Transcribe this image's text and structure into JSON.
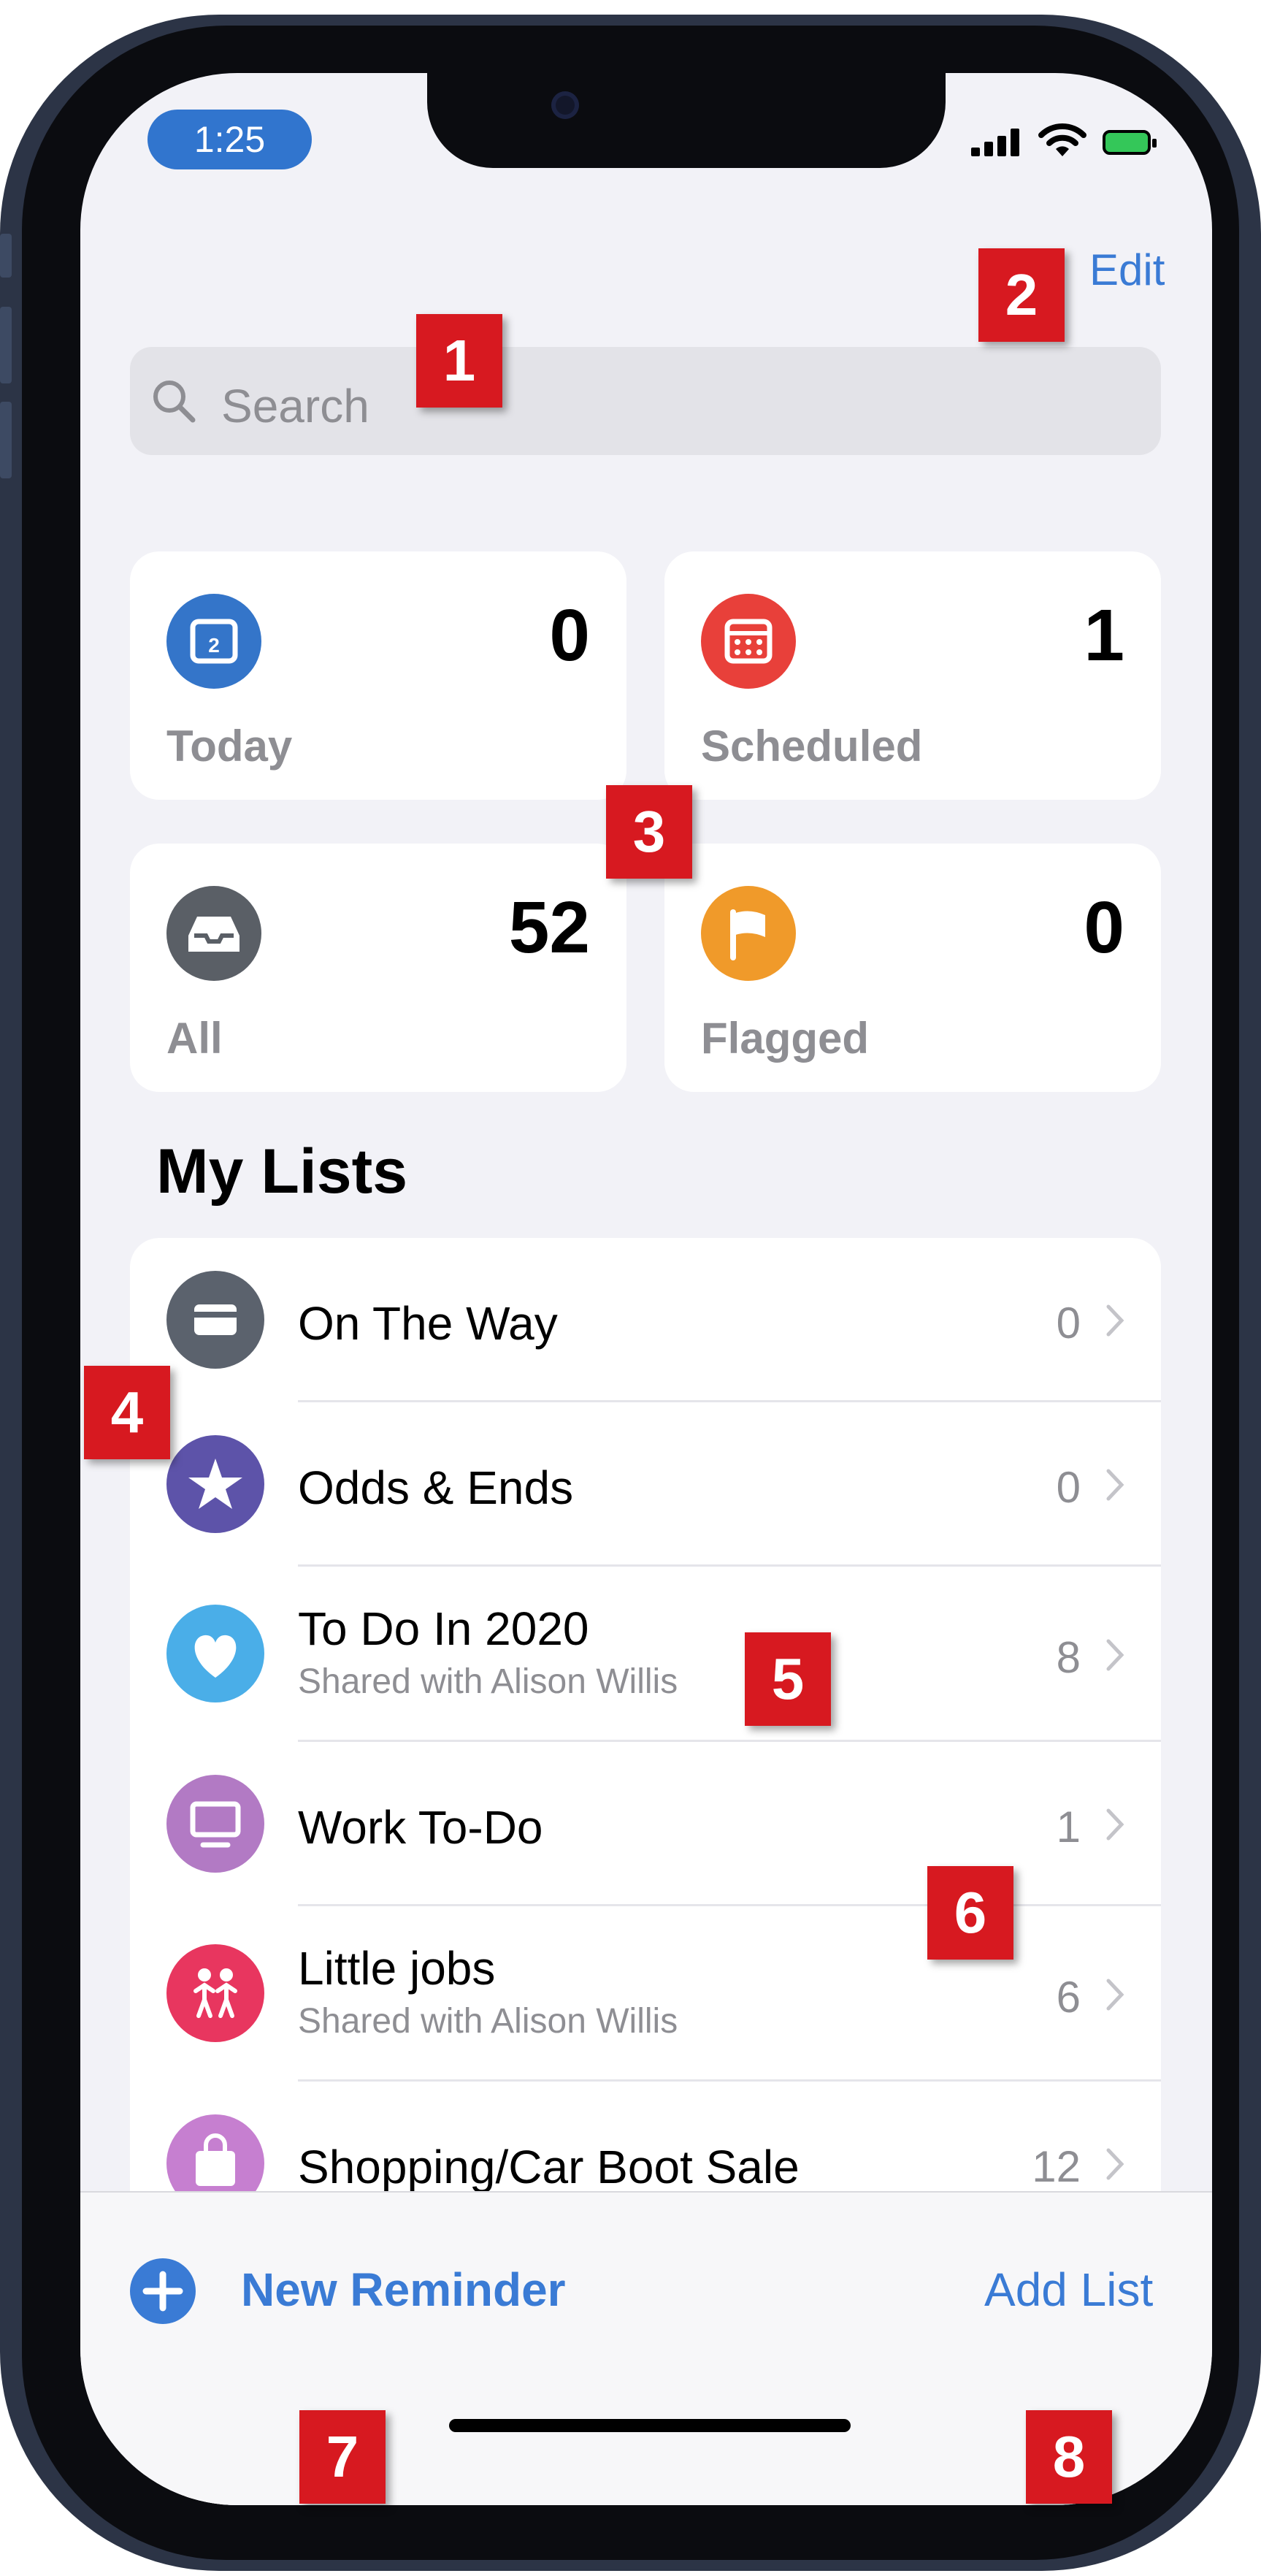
{
  "status_bar": {
    "time": "1:25"
  },
  "header": {
    "edit_label": "Edit"
  },
  "search": {
    "placeholder": "Search"
  },
  "smart_lists": [
    {
      "label": "Today",
      "count": "0",
      "icon": "calendar-today-icon",
      "color": "#3475c9"
    },
    {
      "label": "Scheduled",
      "count": "1",
      "icon": "calendar-scheduled-icon",
      "color": "#e8403a"
    },
    {
      "label": "All",
      "count": "52",
      "icon": "tray-icon",
      "color": "#5a5f66"
    },
    {
      "label": "Flagged",
      "count": "0",
      "icon": "flag-icon",
      "color": "#f09a2a"
    }
  ],
  "my_lists": {
    "title": "My Lists",
    "items": [
      {
        "title": "On The Way",
        "subtitle": "",
        "count": "0",
        "icon": "card-icon",
        "color": "#5b626d"
      },
      {
        "title": "Odds & Ends",
        "subtitle": "",
        "count": "0",
        "icon": "star-icon",
        "color": "#5d53a9"
      },
      {
        "title": "To Do In 2020",
        "subtitle": "Shared with Alison Willis",
        "count": "8",
        "icon": "heart-icon",
        "color": "#4aaee8"
      },
      {
        "title": "Work To-Do",
        "subtitle": "",
        "count": "1",
        "icon": "monitor-icon",
        "color": "#b27ac4"
      },
      {
        "title": "Little jobs",
        "subtitle": "Shared with Alison Willis",
        "count": "6",
        "icon": "people-icon",
        "color": "#e8365f"
      },
      {
        "title": "Shopping/Car Boot Sale",
        "subtitle": "",
        "count": "12",
        "icon": "bag-icon",
        "color": "#c67fd0"
      }
    ]
  },
  "toolbar": {
    "new_reminder_label": "New Reminder",
    "add_list_label": "Add List"
  },
  "annotations": [
    "1",
    "2",
    "3",
    "4",
    "5",
    "6",
    "7",
    "8"
  ],
  "colors": {
    "accent": "#3a7bd5",
    "badge": "#d71920",
    "background": "#f2f2f7"
  }
}
